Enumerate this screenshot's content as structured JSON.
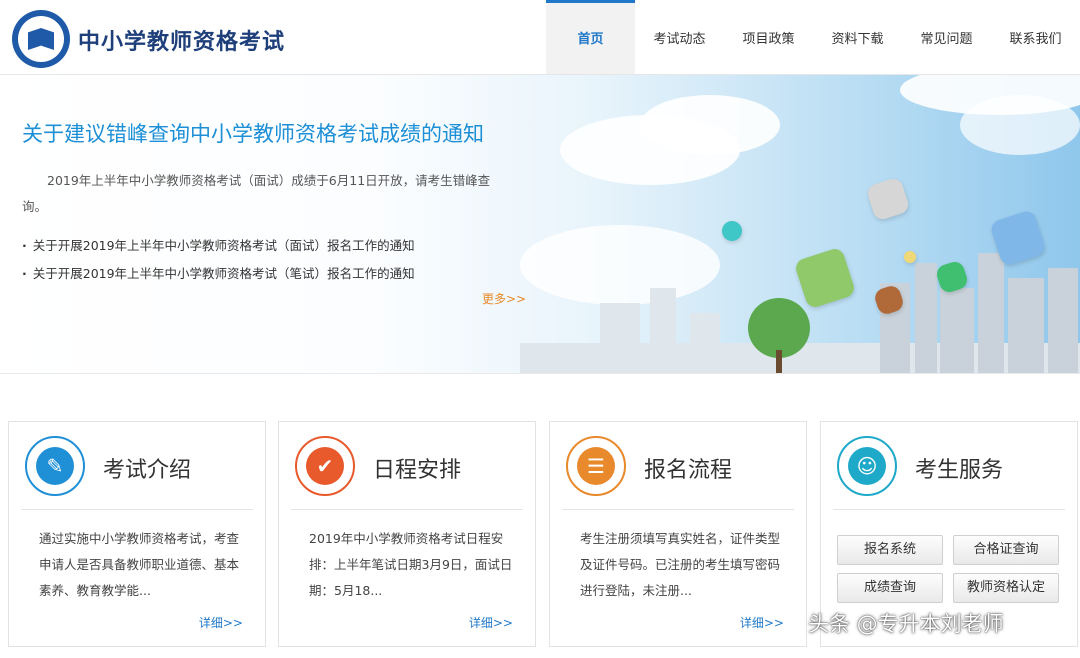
{
  "header": {
    "site_title": "中小学教师资格考试",
    "nav": [
      "首页",
      "考试动态",
      "项目政策",
      "资料下载",
      "常见问题",
      "联系我们"
    ],
    "active_index": 0
  },
  "banner": {
    "headline": "关于建议错峰查询中小学教师资格考试成绩的通知",
    "summary": "2019年上半年中小学教师资格考试（面试）成绩于6月11日开放，请考生错峰查询。",
    "news": [
      "关于开展2019年上半年中小学教师资格考试（面试）报名工作的通知",
      "关于开展2019年上半年中小学教师资格考试（笔试）报名工作的通知"
    ],
    "more": "更多>>"
  },
  "cards": [
    {
      "title": "考试介绍",
      "text": "通过实施中小学教师资格考试，考查申请人是否具备教师职业道德、基本素养、教育教学能...",
      "more": "详细>>",
      "icon": "document-icon",
      "color": "#1f8fd6"
    },
    {
      "title": "日程安排",
      "text": "2019年中小学教师资格考试日程安排：上半年笔试日期3月9日，面试日期：5月18...",
      "more": "详细>>",
      "icon": "checkmark-icon",
      "color": "#e8592b"
    },
    {
      "title": "报名流程",
      "text": "考生注册须填写真实姓名，证件类型及证件号码。已注册的考生填写密码进行登陆，未注册...",
      "more": "详细>>",
      "icon": "form-icon",
      "color": "#e8892b"
    },
    {
      "title": "考生服务",
      "icon": "contact-book-icon",
      "color": "#1fa9c9",
      "buttons": [
        "报名系统",
        "合格证查询",
        "成绩查询",
        "教师资格认定"
      ]
    }
  ],
  "watermark": "头条 @专升本刘老师"
}
